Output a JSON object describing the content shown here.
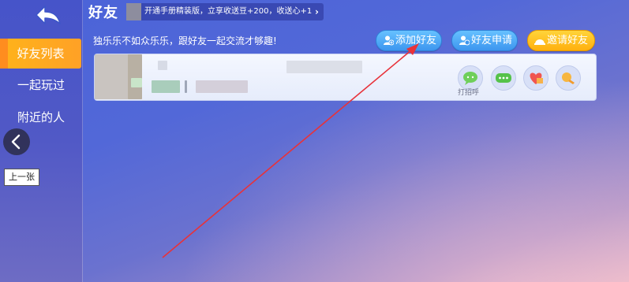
{
  "header": {
    "title": "好友",
    "promo_text": "开通手册精装版，立享收送豆+200，收送心+1",
    "subtitle": "独乐乐不如众乐乐，跟好友一起交流才够趣!"
  },
  "sidebar": {
    "items": [
      {
        "label": "好友列表",
        "active": true
      },
      {
        "label": "一起玩过",
        "active": false
      },
      {
        "label": "附近的人",
        "active": false
      }
    ]
  },
  "actions": {
    "add_friend": "添加好友",
    "friend_requests": "好友申请",
    "invite_friends": "邀请好友"
  },
  "friend_row": {
    "greet_label": "打招呼",
    "action_icons": [
      "wave-greet-icon",
      "chat-icon",
      "send-heart-icon",
      "gift-icon"
    ]
  },
  "overlay": {
    "prev_tooltip": "上一张"
  },
  "colors": {
    "accent_orange": "#ffa126",
    "button_blue": "#3d96ef",
    "button_yellow": "#ffb00e",
    "annotation_arrow": "#e8323a"
  }
}
